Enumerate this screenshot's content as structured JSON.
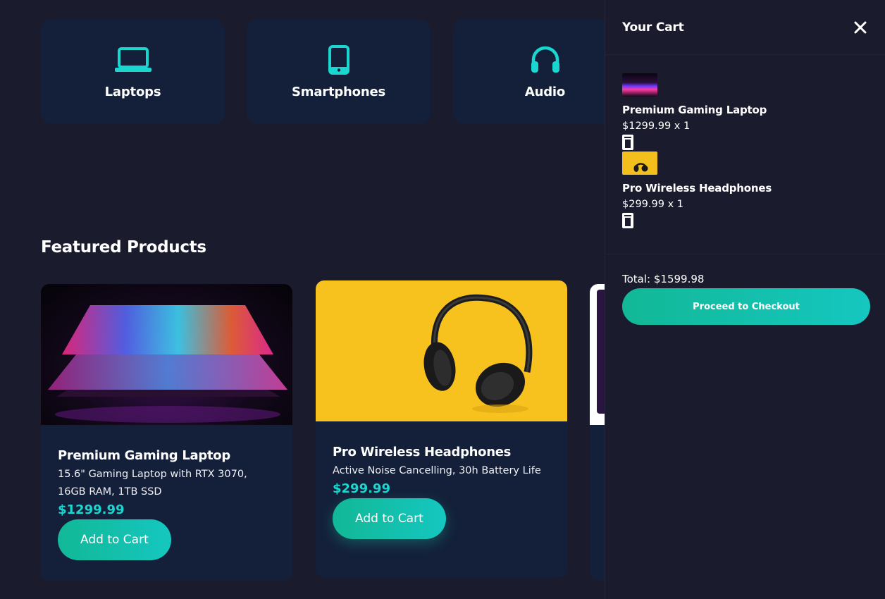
{
  "categories": [
    {
      "label": "Laptops",
      "icon": "laptop-icon"
    },
    {
      "label": "Smartphones",
      "icon": "smartphone-icon"
    },
    {
      "label": "Audio",
      "icon": "headphones-icon"
    }
  ],
  "featured": {
    "title": "Featured Products",
    "products": [
      {
        "title": "Premium Gaming Laptop",
        "description": "15.6\" Gaming Laptop with RTX 3070, 16GB RAM, 1TB SSD",
        "price": "$1299.99",
        "button": "Add to Cart"
      },
      {
        "title": "Pro Wireless Headphones",
        "description": "Active Noise Cancelling, 30h Battery Life",
        "price": "$299.99",
        "button": "Add to Cart"
      }
    ]
  },
  "cart": {
    "title": "Your Cart",
    "items": [
      {
        "name": "Premium Gaming Laptop",
        "price_qty": "$1299.99 x 1"
      },
      {
        "name": "Pro Wireless Headphones",
        "price_qty": "$299.99 x 1"
      }
    ],
    "total": "Total: $1599.98",
    "checkout": "Proceed to Checkout"
  },
  "colors": {
    "background": "#1b1b2e",
    "card": "#14203a",
    "accent": "#19d6cf",
    "button_gradient_start": "#12b896",
    "button_gradient_end": "#15c7c0"
  }
}
